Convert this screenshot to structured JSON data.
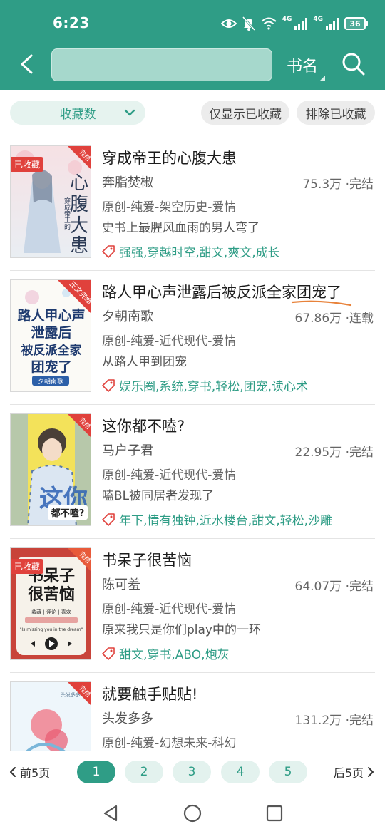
{
  "status_bar": {
    "time": "6:23",
    "net1": "4G",
    "net2": "4G",
    "battery": "36",
    "icons": [
      "eye-icon",
      "mute-icon",
      "wifi-icon",
      "signal-icon",
      "battery-icon"
    ]
  },
  "toolbar": {
    "search_value": "",
    "mode_label": "书名"
  },
  "filters": {
    "sort_label": "收藏数",
    "only_collected": "仅显示已收藏",
    "exclude_collected": "排除已收藏"
  },
  "colors": {
    "primary": "#2f9d86",
    "badge_red": "#e0413c",
    "underline": "#e8823a"
  },
  "books": [
    {
      "title": "穿成帝王的心腹大患",
      "author": "奔脂焚椒",
      "count": "75.3万",
      "status": "·完结",
      "category": "原创-纯爱-架空历史-爱情",
      "desc": "史书上最腥风血雨的男人弯了",
      "tags": "强强,穿越时空,甜文,爽文,成长",
      "collected": true,
      "collected_label": "已收藏",
      "cover_ribbon": "完结",
      "cover_text": "心腹大患",
      "cover_sub": "穿成帝王的"
    },
    {
      "title": "路人甲心声泄露后被反派全家团宠了",
      "author": "夕朝南歌",
      "count": "67.86万",
      "status": "·连载",
      "category": "原创-纯爱-近代现代-爱情",
      "desc": "从路人甲到团宠",
      "tags": "娱乐圈,系统,穿书,轻松,团宠,读心术",
      "collected": false,
      "cover_ribbon": "正文完结",
      "cover_text": "路人甲心声泄露后被反派全家团宠了",
      "cover_sub": "夕朝南歌"
    },
    {
      "title": "这你都不嗑?",
      "author": "马户子君",
      "count": "22.95万",
      "status": "·完结",
      "category": "原创-纯爱-近代现代-爱情",
      "desc": "嗑BL被同居者发现了",
      "tags": "年下,情有独钟,近水楼台,甜文,轻松,沙雕",
      "collected": false,
      "cover_ribbon": "完结",
      "cover_text": "都不嗑?",
      "cover_sub": ""
    },
    {
      "title": "书呆子很苦恼",
      "author": "陈可羞",
      "count": "64.07万",
      "status": "·完结",
      "category": "原创-纯爱-近代现代-爱情",
      "desc": "原来我只是你们play中的一环",
      "tags": "甜文,穿书,ABO,炮灰",
      "collected": true,
      "collected_label": "已收藏",
      "cover_ribbon": "完结",
      "cover_text": "书呆子很苦恼",
      "cover_sub": "\"Is missing you in the dream\""
    },
    {
      "title": "就要触手贴贴!",
      "author": "头发多多",
      "count": "131.2万",
      "status": "·完结",
      "category": "原创-纯爱-幻想未来-科幻",
      "desc": "",
      "tags": "",
      "collected": false,
      "cover_ribbon": "完结",
      "cover_text": "",
      "cover_sub": ""
    }
  ],
  "pagination": {
    "prev": "前5页",
    "next": "后5页",
    "pages": [
      "1",
      "2",
      "3",
      "4",
      "5"
    ],
    "current": "1"
  }
}
